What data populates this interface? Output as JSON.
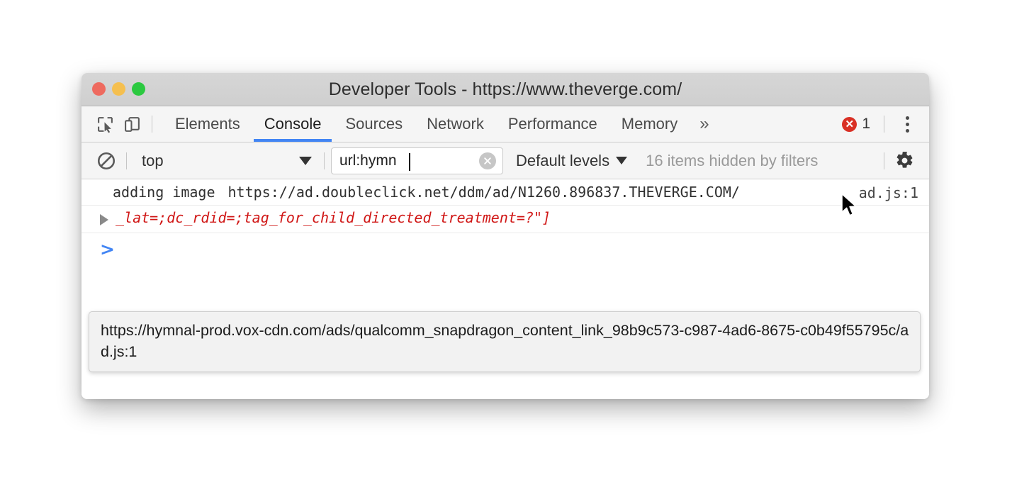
{
  "window": {
    "title": "Developer Tools - https://www.theverge.com/",
    "traffic_lights": [
      {
        "name": "close",
        "color": "#ee6a5f"
      },
      {
        "name": "minimize",
        "color": "#f5bf4f"
      },
      {
        "name": "maximize",
        "color": "#2bc940"
      }
    ]
  },
  "tabstrip": {
    "inspect_icon": "inspect-element-icon",
    "device_icon": "device-toolbar-icon",
    "tabs": [
      {
        "label": "Elements",
        "active": false
      },
      {
        "label": "Console",
        "active": true
      },
      {
        "label": "Sources",
        "active": false
      },
      {
        "label": "Network",
        "active": false
      },
      {
        "label": "Performance",
        "active": false
      },
      {
        "label": "Memory",
        "active": false
      }
    ],
    "more_tabs_label": "»",
    "error_badge": {
      "glyph": "✕",
      "count": "1",
      "color": "#d93025"
    },
    "menu_label": "kebab-menu"
  },
  "filterbar": {
    "clear_console_icon": "clear-console-icon",
    "context": {
      "value": "top",
      "caret": "▼"
    },
    "filter": {
      "value": "url:hymn",
      "placeholder": "Filter",
      "clear_glyph": "✕"
    },
    "levels": {
      "label": "Default levels",
      "caret": "▼"
    },
    "hidden_message": "16 items hidden by filters",
    "settings_icon": "gear-icon"
  },
  "console": {
    "messages": [
      {
        "text": "adding image",
        "url": "https://ad.doubleclick.net/ddm/ad/N1260.896837.THEVERGE.COM/",
        "source": "ad.js:1"
      }
    ],
    "error_entry": {
      "line": "_lat=;dc_rdid=;tag_for_child_directed_treatment=?\"]",
      "expander": "▶"
    },
    "prompt": ">"
  },
  "tooltip": {
    "url": "https://hymnal-prod.vox-cdn.com/ads/qualcomm_snapdragon_content_link_98b9c573-c987-4ad6-8675-c0b49f55795c/ad.js:1"
  },
  "colors": {
    "accent": "#4285f4",
    "error": "#d93025",
    "error_text": "#d01716"
  }
}
